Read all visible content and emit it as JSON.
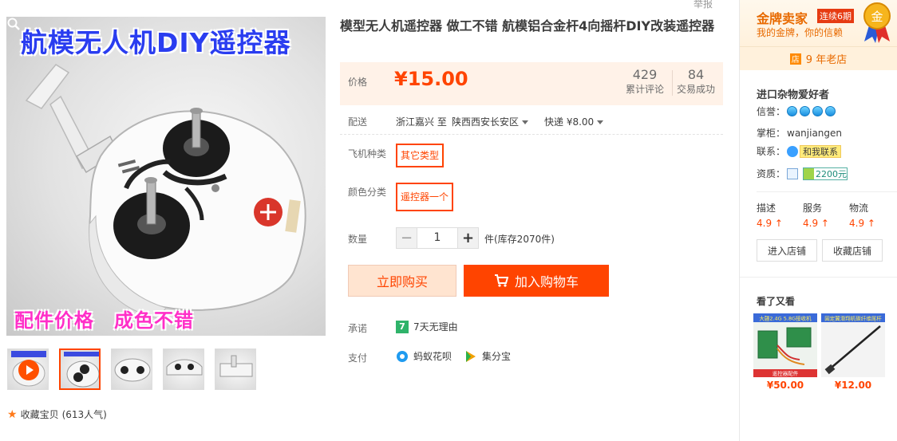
{
  "gallery": {
    "main_title": "航模无人机DIY遥控器",
    "main_caption": "配件价格　成色不错",
    "thumb_count": 5
  },
  "report_link": "举报",
  "product": {
    "title": "模型无人机遥控器 做工不错 航模铝合金杆4向摇杆DIY改装遥控器",
    "price_label": "价格",
    "price": "¥15.00",
    "reviews_count": "429",
    "reviews_label": "累计评论",
    "deals_count": "84",
    "deals_label": "交易成功",
    "shipping_label": "配送",
    "ship_from": "浙江嘉兴 至",
    "ship_to": "陕西西安长安区",
    "ship_method": "快递 ¥8.00",
    "option1_label": "飞机种类",
    "option1_value": "其它类型",
    "option2_label": "颜色分类",
    "option2_value": "遥控器一个",
    "qty_label": "数量",
    "qty_minus": "−",
    "qty_value": "1",
    "qty_plus": "+",
    "stock": "件(库存2070件)",
    "buy_now": "立即购买",
    "add_to_cart": "加入购物车",
    "promise_label": "承诺",
    "promise_icon": "7",
    "promise_text": "7天无理由",
    "pay_label": "支付",
    "pay1": "蚂蚁花呗",
    "pay2": "集分宝",
    "favorite": "收藏宝贝",
    "favorite_count": "(613人气)"
  },
  "shop": {
    "gold_title": "金牌卖家",
    "gold_badge": "连续6期",
    "gold_sub": "我的金牌，你的信赖",
    "medal_char": "金",
    "years_icon": "店",
    "years": "9 年老店",
    "name": "进口杂物爱好者",
    "credit_label": "信誉：",
    "keeper_label": "掌柜：",
    "keeper": "wanjiangen",
    "contact_label": "联系：",
    "contact_btn": "和我联系",
    "qual_label": "资质：",
    "deposit": "2200元",
    "scores": [
      {
        "name": "描述",
        "value": "4.9 ↑"
      },
      {
        "name": "服务",
        "value": "4.9 ↑"
      },
      {
        "name": "物流",
        "value": "4.9 ↑"
      }
    ],
    "enter_shop": "进入店铺",
    "fav_shop": "收藏店铺",
    "seen_title": "看了又看",
    "seen": [
      {
        "caption": "大疆2.4G 5.8G接收机",
        "caption_bottom": "遥控器配件",
        "price": "¥50.00"
      },
      {
        "caption": "固定翼滑翔机碳纤维尾杆",
        "caption_bottom": "",
        "price": "¥12.00"
      }
    ]
  },
  "colors": {
    "accent": "#ff4400",
    "price_bg": "#fff2e8",
    "gold": "#e86a00"
  }
}
